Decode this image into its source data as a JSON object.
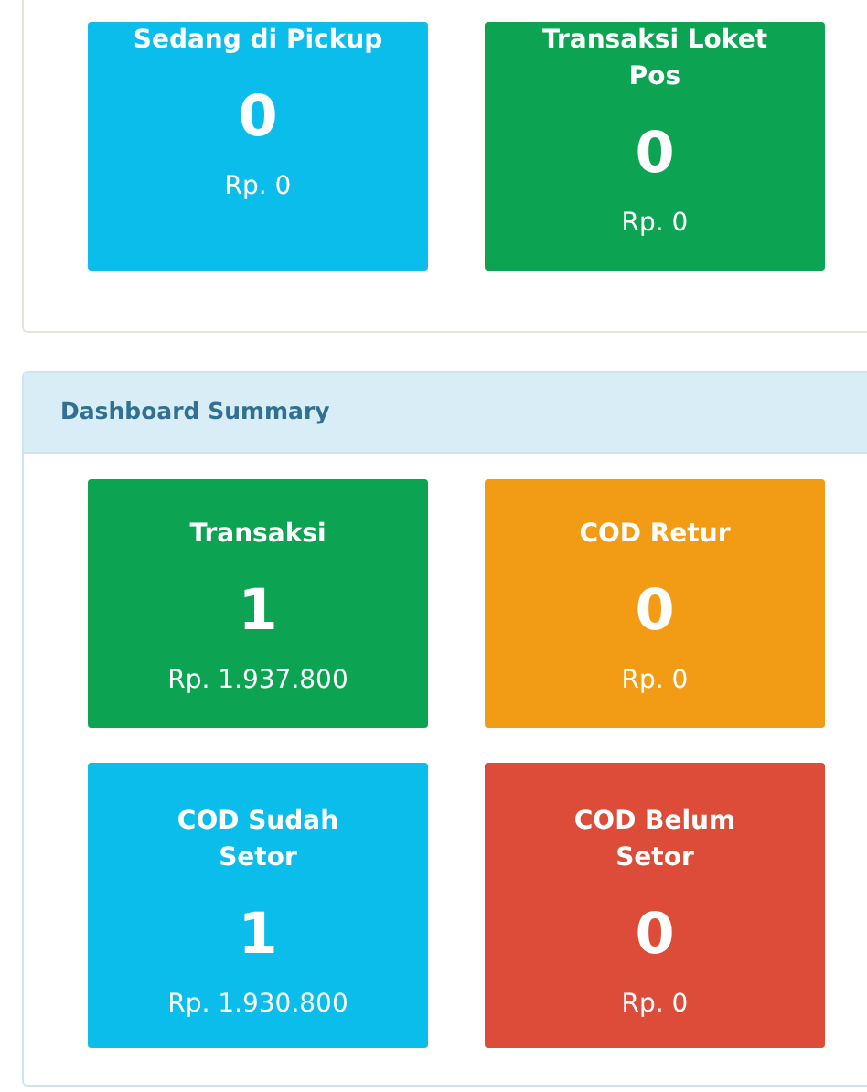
{
  "top_panel": {
    "tiles": [
      {
        "title": "Sedang di Pickup",
        "count": "0",
        "amount": "Rp. 0",
        "color": "#0bbdeb"
      },
      {
        "title": "Transaksi Loket Pos",
        "count": "0",
        "amount": "Rp. 0",
        "color": "#0ca352"
      }
    ]
  },
  "summary_panel": {
    "title": "Dashboard Summary",
    "tiles": [
      {
        "title": "Transaksi",
        "count": "1",
        "amount": "Rp. 1.937.800",
        "color": "#0ca352"
      },
      {
        "title": "COD Retur",
        "count": "0",
        "amount": "Rp. 0",
        "color": "#f29c16"
      },
      {
        "title": "COD Sudah Setor",
        "count": "1",
        "amount": "Rp. 1.930.800",
        "color": "#0bbdeb"
      },
      {
        "title": "COD Belum Setor",
        "count": "0",
        "amount": "Rp. 0",
        "color": "#dd4b39"
      }
    ]
  }
}
